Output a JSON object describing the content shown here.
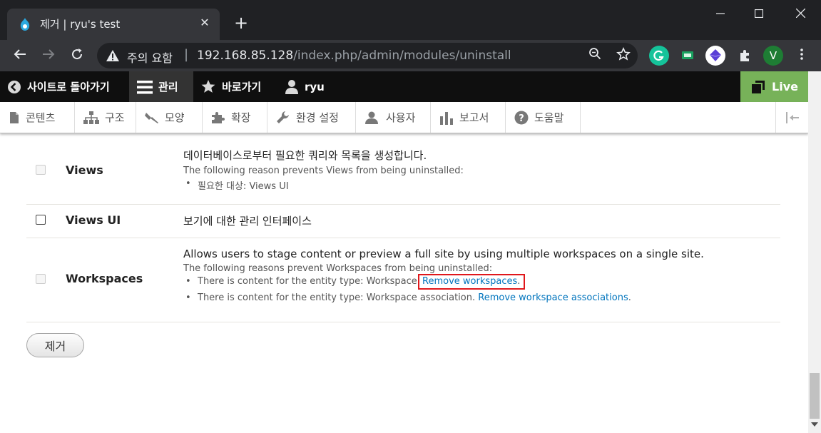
{
  "browser": {
    "tab_title": "제거 | ryu's test",
    "new_tab": "+",
    "close_tab": "✕",
    "security_text": "주의 요함",
    "url_host": "192.168.85.128",
    "url_path": "/index.php/admin/modules/uninstall",
    "profile_initial": "V"
  },
  "admin_toolbar": {
    "back_to_site": "사이트로 돌아가기",
    "manage": "관리",
    "shortcuts": "바로가기",
    "user": "ryu",
    "workspace": "Live"
  },
  "tray": {
    "items": [
      "콘텐츠",
      "구조",
      "모양",
      "확장",
      "환경 설정",
      "사용자",
      "보고서",
      "도움말"
    ]
  },
  "modules": [
    {
      "name": "Views",
      "description": "데이터베이스로부터 필요한 쿼리와 목록을 생성합니다.",
      "note": "The following reason prevents Views from being uninstalled:",
      "reasons": [
        {
          "text": "필요한 대상: Views UI",
          "link": "",
          "suffix": ""
        }
      ]
    },
    {
      "name": "Views UI",
      "description": "보기에 대한 관리 인터페이스"
    },
    {
      "name": "Workspaces",
      "description": "Allows users to stage content or preview a full site by using multiple workspaces on a single site.",
      "note": "The following reasons prevent Workspaces from being uninstalled:",
      "reasons": [
        {
          "text": "There is content for the entity type: Workspace.",
          "link": "Remove workspaces",
          "suffix": "."
        },
        {
          "text": "There is content for the entity type: Workspace association.",
          "link": "Remove workspace associations",
          "suffix": "."
        }
      ]
    }
  ],
  "form": {
    "submit_label": "제거"
  }
}
